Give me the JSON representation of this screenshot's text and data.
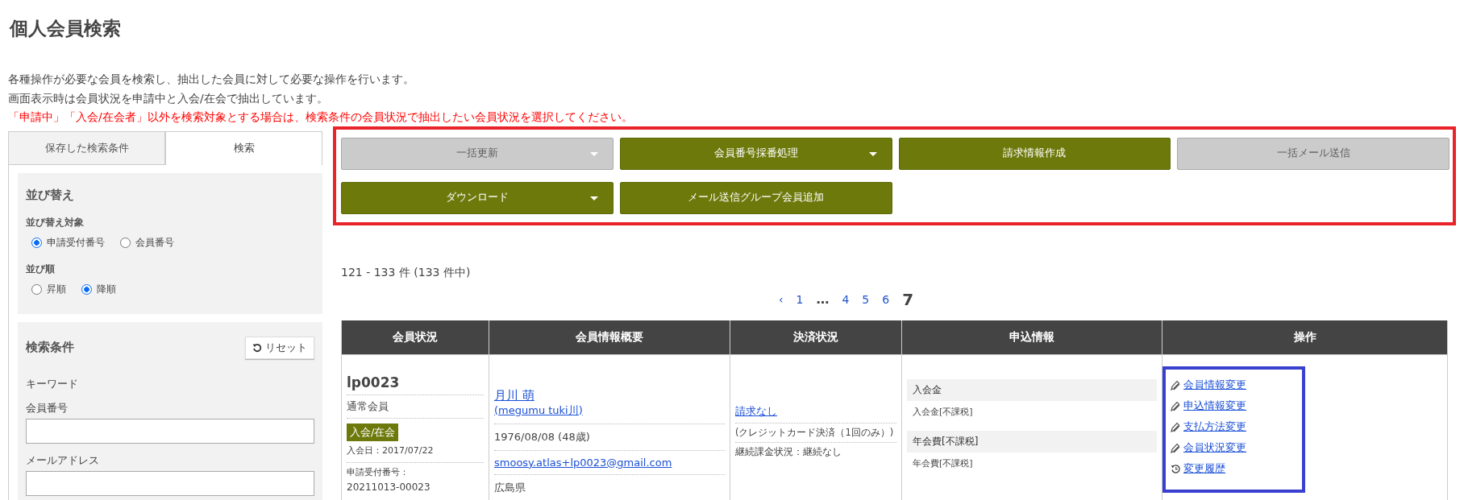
{
  "title": "個人会員検索",
  "description": [
    {
      "text": "各種操作が必要な会員を検索し、抽出した会員に対して必要な操作を行います。",
      "warning": false
    },
    {
      "text": "画面表示時は会員状況を申請中と入会/在会で抽出しています。",
      "warning": false
    },
    {
      "text": "「申請中」「入会/在会者」以外を検索対象とする場合は、検索条件の会員状況で抽出したい会員状況を選択してください。",
      "warning": true
    }
  ],
  "sidebar": {
    "tabs": [
      {
        "label": "保存した検索条件",
        "selected": false
      },
      {
        "label": "検索",
        "selected": true
      }
    ],
    "sort": {
      "heading": "並び替え",
      "groups": [
        {
          "label": "並び替え対象",
          "options": [
            {
              "label": "申請受付番号",
              "selected": true
            },
            {
              "label": "会員番号",
              "selected": false
            }
          ]
        },
        {
          "label": "並び順",
          "options": [
            {
              "label": "昇順",
              "selected": false
            },
            {
              "label": "降順",
              "selected": true
            }
          ]
        }
      ]
    },
    "conditions": {
      "heading": "検索条件",
      "reset_button": "リセット",
      "subheading": "キーワード",
      "fields": [
        {
          "label": "会員番号"
        },
        {
          "label": "メールアドレス"
        }
      ]
    }
  },
  "action_buttons": [
    {
      "label": "一括更新",
      "disabled": true,
      "dropdown": true
    },
    {
      "label": "会員番号採番処理",
      "disabled": false,
      "dropdown": true
    },
    {
      "label": "請求情報作成",
      "disabled": false,
      "dropdown": false
    },
    {
      "label": "一括メール送信",
      "disabled": true,
      "dropdown": false
    },
    {
      "label": "ダウンロード",
      "disabled": false,
      "dropdown": true
    },
    {
      "label": "メール送信グループ会員追加",
      "disabled": false,
      "dropdown": false
    }
  ],
  "result_count": "121 - 133 件 (133 件中)",
  "pagination": [
    {
      "kind": "prev",
      "label": "‹",
      "selected": false
    },
    {
      "kind": "page",
      "label": "1",
      "selected": false
    },
    {
      "kind": "gap",
      "label": "…",
      "selected": false
    },
    {
      "kind": "page",
      "label": "4",
      "selected": false
    },
    {
      "kind": "page",
      "label": "5",
      "selected": false
    },
    {
      "kind": "page",
      "label": "6",
      "selected": false
    },
    {
      "kind": "page",
      "label": "7",
      "selected": true
    }
  ],
  "table": {
    "columns": [
      "会員状況",
      "会員情報概要",
      "決済状況",
      "申込情報",
      "操作"
    ],
    "rows": [
      {
        "member_id": "lp0023",
        "member_type": "通常会員",
        "status": "入会/在会",
        "join_date": "入会日：2017/07/22",
        "application_label": "申請受付番号：",
        "application_number": "20211013-00023",
        "name": "月川 萌",
        "name_reading": "(megumu tuki川)",
        "birth": "1976/08/08 (48歳)",
        "email": "smoosy.atlas+lp0023@gmail.com",
        "prefecture": "広島県",
        "billing": "請求なし",
        "payment_method": "(クレジットカード決済（1回のみ）)",
        "recurring": "継続課金状況：継続なし",
        "application": [
          {
            "heading": "入会金",
            "detail": "入会金[不課税]"
          },
          {
            "heading": "年会費[不課税]",
            "detail": "年会費[不課税]"
          }
        ],
        "actions": [
          {
            "kind": "edit",
            "label": "会員情報変更"
          },
          {
            "kind": "edit",
            "label": "申込情報変更"
          },
          {
            "kind": "edit",
            "label": "支払方法変更"
          },
          {
            "kind": "edit",
            "label": "会員状況変更"
          },
          {
            "kind": "history",
            "label": "変更履歴"
          }
        ]
      }
    ]
  }
}
